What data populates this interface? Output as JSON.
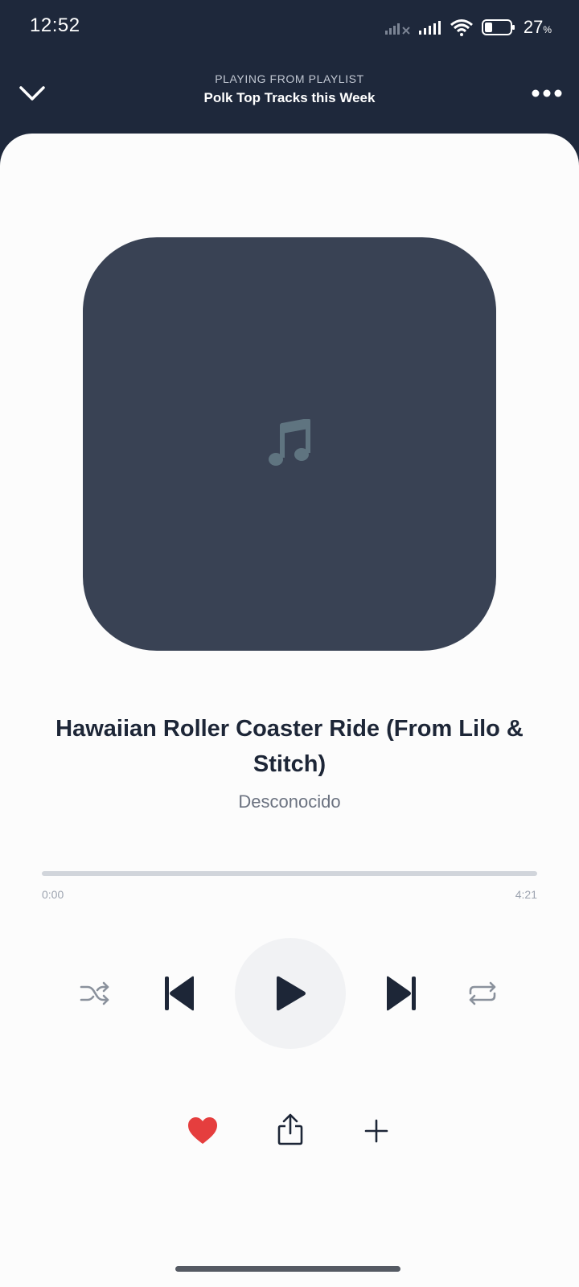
{
  "status_bar": {
    "time": "12:52",
    "battery_percent": "27",
    "battery_unit": "%"
  },
  "header": {
    "eyebrow": "PLAYING FROM PLAYLIST",
    "playlist_name": "Polk Top Tracks this Week"
  },
  "track": {
    "title": "Hawaiian Roller Coaster Ride (From Lilo & Stitch)",
    "artist": "Desconocido"
  },
  "progress": {
    "elapsed": "0:00",
    "total": "4:21",
    "fraction": 0
  },
  "colors": {
    "header_bg": "#1e283b",
    "artwork_bg": "#394254",
    "music_note": "#5f7480",
    "like_red": "#e53e3e"
  },
  "icons": {
    "collapse": "chevron-down-icon",
    "more": "more-dots-icon",
    "artwork": "music-note-icon",
    "shuffle": "shuffle-icon",
    "previous": "skip-previous-icon",
    "play": "play-icon",
    "next": "skip-next-icon",
    "repeat": "repeat-icon",
    "like": "heart-icon",
    "share": "share-icon",
    "add": "plus-icon"
  }
}
